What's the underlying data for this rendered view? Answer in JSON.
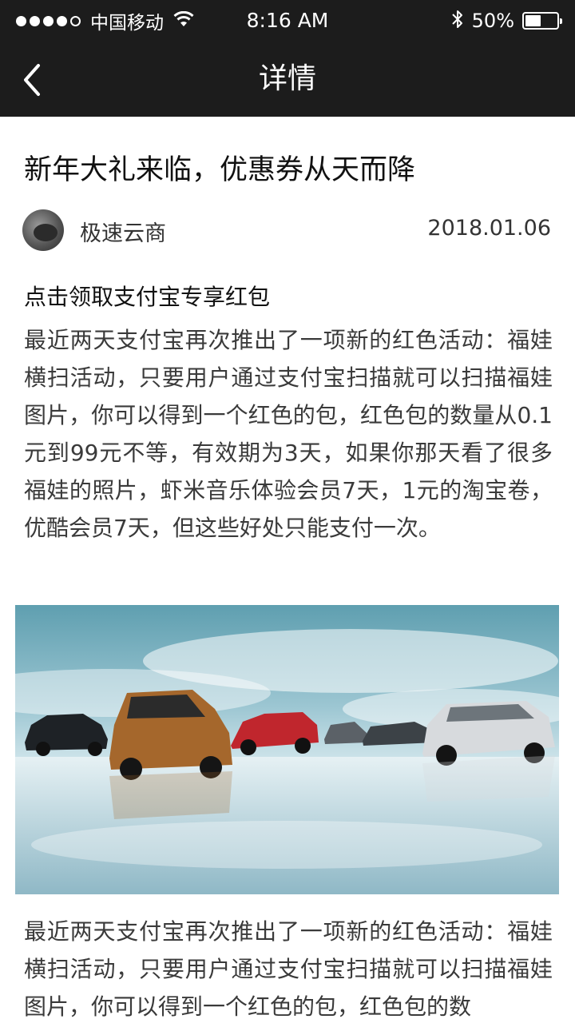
{
  "status_bar": {
    "carrier": "中国移动",
    "time": "8:16 AM",
    "battery_percent": "50%",
    "battery_level": 0.5,
    "signal_bars_filled": 4,
    "signal_bars_total": 5
  },
  "nav": {
    "title": "详情",
    "back_icon": "chevron-left-icon"
  },
  "article": {
    "title": "新年大礼来临，优惠券从天而降",
    "author": "极速云商",
    "date": "2018.01.06",
    "section_heading": "点击领取支付宝专享红包",
    "paragraph_1": "最近两天支付宝再次推出了一项新的红色活动：福娃横扫活动，只要用户通过支付宝扫描就可以扫描福娃图片，你可以得到一个红色的包，红色包的数量从0.1元到99元不等，有效期为3天，如果你那天看了很多福娃的照片，虾米音乐体验会员7天，1元的淘宝卷，优酷会员7天，但这些好处只能支付一次。",
    "paragraph_2": "最近两天支付宝再次推出了一项新的红色活动：福娃横扫活动，只要用户通过支付宝扫描就可以扫描福娃图片，你可以得到一个红色的包，红色包的数"
  },
  "colors": {
    "bar_background": "#1c1c1c",
    "text_primary": "#111111",
    "text_body": "#3a3a3a"
  }
}
